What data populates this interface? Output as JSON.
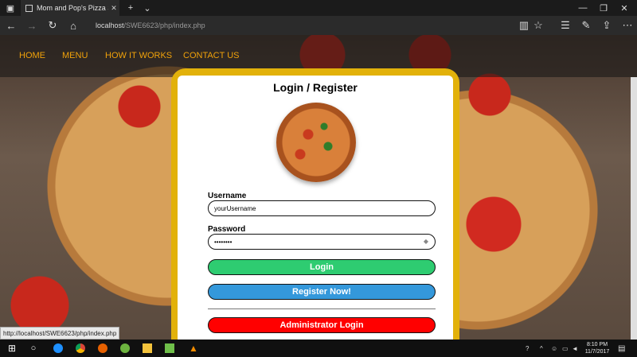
{
  "browser": {
    "tab_title": "Mom and Pop's Pizza Sl",
    "url_host": "localhost",
    "url_path": "/SWE6623/php/index.php",
    "status_url": "http://localhost/SWE6623/php/index.php"
  },
  "nav": {
    "items": [
      "HOME",
      "MENU",
      "HOW IT WORKS",
      "CONTACT US"
    ],
    "color": "#f0a20a"
  },
  "card": {
    "title": "Login / Register",
    "username_label": "Username",
    "username_value": "yourUsername",
    "password_label": "Password",
    "password_value": "••••••••",
    "login_label": "Login",
    "register_label": "Register Now!",
    "admin_label": "Administrator Login",
    "colors": {
      "frame": "#e2b10a",
      "login": "#2ecc71",
      "register": "#3498db",
      "admin": "#ff0000"
    }
  },
  "taskbar": {
    "time": "8:10 PM",
    "date": "11/7/2017"
  }
}
